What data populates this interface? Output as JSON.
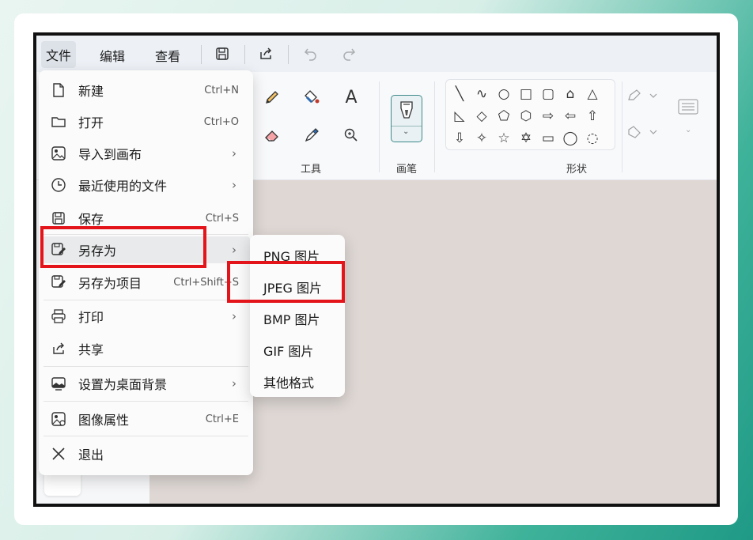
{
  "menubar": {
    "file": "文件",
    "edit": "编辑",
    "view": "查看"
  },
  "quick_access": [
    {
      "icon": "save-icon",
      "enabled": true
    },
    {
      "icon": "share-icon",
      "enabled": true
    },
    {
      "icon": "undo-icon",
      "enabled": false
    },
    {
      "icon": "redo-icon",
      "enabled": false
    }
  ],
  "ribbon": {
    "tools_label": "工具",
    "brush_label": "画笔",
    "shapes_label": "形状",
    "tools": [
      "pencil-icon",
      "fill-icon",
      "text-icon",
      "eraser-icon",
      "color-picker-icon",
      "magnifier-icon"
    ],
    "shapes": [
      "╲",
      "∿",
      "○",
      "□",
      "▢",
      "⌂",
      "△",
      "◺",
      "◇",
      "⬠",
      "⬡",
      "⇨",
      "⇦",
      "⇧",
      "⇩",
      "✧",
      "☆",
      "✡",
      "▭",
      "◯",
      "◌"
    ]
  },
  "file_menu": {
    "items": [
      {
        "icon": "new-file-icon",
        "label": "新建",
        "shortcut": "Ctrl+N"
      },
      {
        "icon": "folder-icon",
        "label": "打开",
        "shortcut": "Ctrl+O"
      },
      {
        "icon": "import-image-icon",
        "label": "导入到画布",
        "submenu": true
      },
      {
        "icon": "clock-icon",
        "label": "最近使用的文件",
        "submenu": true
      },
      {
        "icon": "save-icon",
        "label": "保存",
        "shortcut": "Ctrl+S"
      },
      {
        "icon": "save-as-icon",
        "label": "另存为",
        "submenu": true,
        "highlighted": true
      },
      {
        "icon": "save-as-project-icon",
        "label": "另存为项目",
        "shortcut": "Ctrl+Shift+S"
      },
      {
        "icon": "print-icon",
        "label": "打印",
        "submenu": true
      },
      {
        "icon": "share-icon",
        "label": "共享"
      },
      {
        "icon": "wallpaper-icon",
        "label": "设置为桌面背景",
        "submenu": true
      },
      {
        "icon": "image-properties-icon",
        "label": "图像属性",
        "shortcut": "Ctrl+E"
      },
      {
        "icon": "close-icon",
        "label": "退出"
      }
    ]
  },
  "save_as_submenu": {
    "items": [
      "PNG 图片",
      "JPEG 图片",
      "BMP 图片",
      "GIF 图片",
      "其他格式"
    ],
    "highlighted": "JPEG 图片"
  },
  "colors": {
    "highlight_box": "#e4141b",
    "canvas": "#ded7d4",
    "accent": "#1f9a86"
  }
}
